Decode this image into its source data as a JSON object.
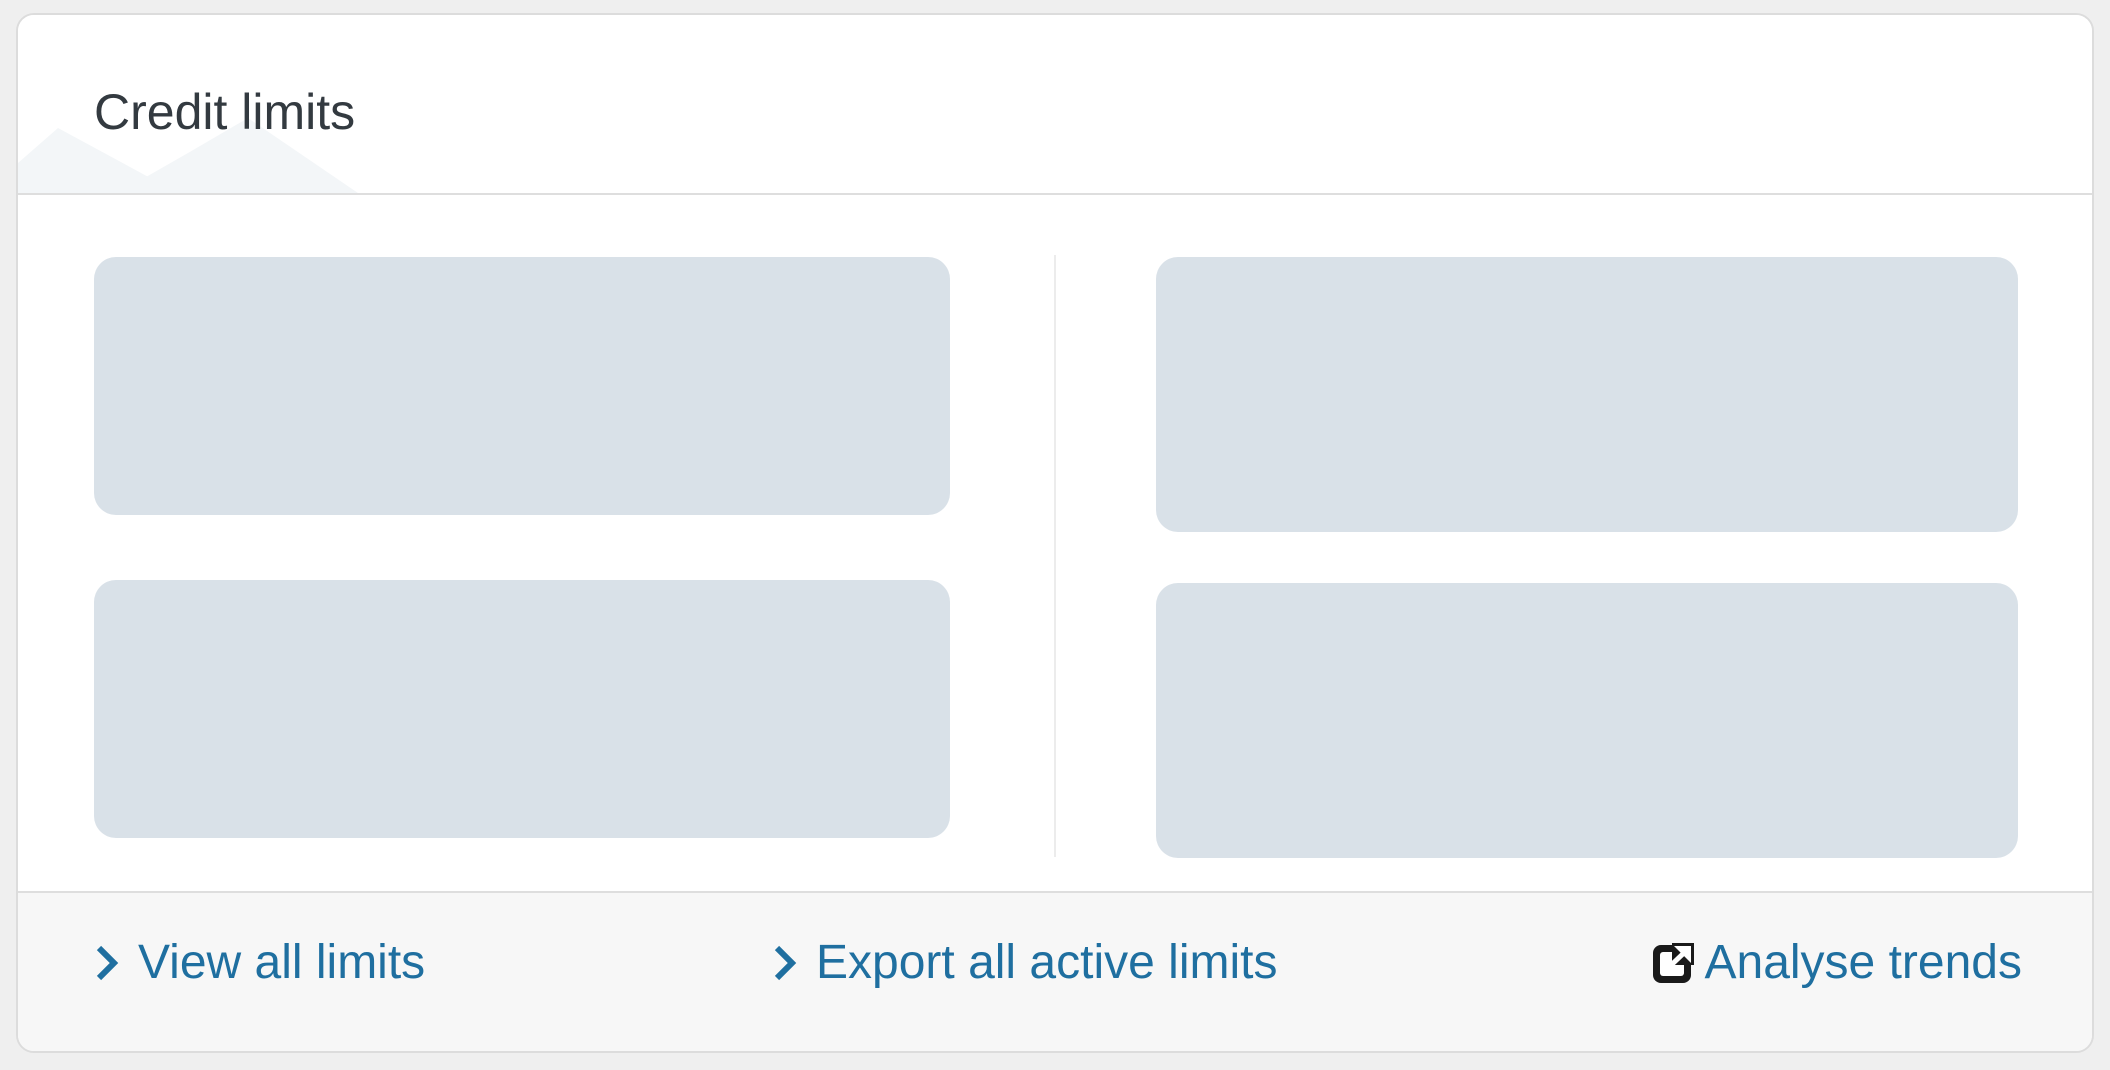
{
  "card": {
    "title": "Credit limits"
  },
  "placeholders": [
    {
      "state": "loading"
    },
    {
      "state": "loading"
    },
    {
      "state": "loading"
    },
    {
      "state": "loading"
    }
  ],
  "footer": {
    "links": [
      {
        "label": "View all limits",
        "icon": "chevron-right-icon"
      },
      {
        "label": "Export all active limits",
        "icon": "chevron-right-icon"
      },
      {
        "label": "Analyse trends",
        "icon": "external-link-icon"
      }
    ]
  },
  "colors": {
    "link": "#1f6fa0",
    "title": "#333a40",
    "skeleton": "#d9e1e8",
    "footer_bg": "#f7f7f7"
  }
}
